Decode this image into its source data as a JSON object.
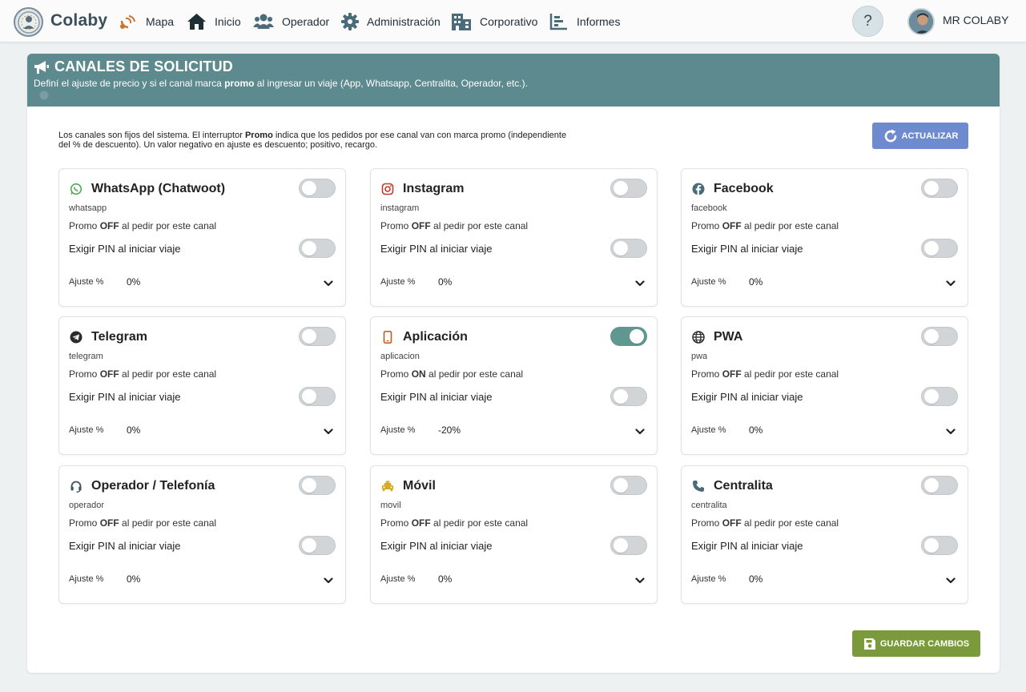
{
  "nav": {
    "brand_co": "Co",
    "brand_rest": "laby",
    "items": [
      {
        "label": "Mapa",
        "icon": "satellite-icon"
      },
      {
        "label": "Inicio",
        "icon": "home-icon"
      },
      {
        "label": "Operador",
        "icon": "users-icon"
      },
      {
        "label": "Administración",
        "icon": "gear-icon"
      },
      {
        "label": "Corporativo",
        "icon": "building-icon"
      },
      {
        "label": "Informes",
        "icon": "chart-icon"
      }
    ],
    "help": "?",
    "user_name": "MR COLABY"
  },
  "header": {
    "title": "CANALES DE SOLICITUD",
    "subtitle_pre": "Definí el ajuste de precio y si el canal marca ",
    "subtitle_bold": "promo",
    "subtitle_post": " al ingresar un viaje (App, Whatsapp, Centralita, Operador, etc.)."
  },
  "info": {
    "pre": "Los canales son fijos del sistema. El interruptor ",
    "bold": "Promo",
    "post": " indica que los pedidos por ese canal van con marca promo (independiente del % de descuento). Un valor negativo en ajuste es descuento; positivo, recargo."
  },
  "refresh_label": "ACTUALIZAR",
  "save_label": "GUARDAR CAMBIOS",
  "labels": {
    "promo_pre": "Promo ",
    "promo_post": " al pedir por este canal",
    "pin": "Exigir PIN al iniciar viaje",
    "adjust": "Ajuste %"
  },
  "channels": [
    {
      "name": "WhatsApp (Chatwoot)",
      "code": "whatsapp",
      "promo": "OFF",
      "promo_on": false,
      "pin_on": false,
      "adjust": "0%",
      "icon": "whatsapp-icon",
      "color": "#4caf50"
    },
    {
      "name": "Instagram",
      "code": "instagram",
      "promo": "OFF",
      "promo_on": false,
      "pin_on": false,
      "adjust": "0%",
      "icon": "instagram-icon",
      "color": "#c0392b"
    },
    {
      "name": "Facebook",
      "code": "facebook",
      "promo": "OFF",
      "promo_on": false,
      "pin_on": false,
      "adjust": "0%",
      "icon": "facebook-icon",
      "color": "#4a6b78"
    },
    {
      "name": "Telegram",
      "code": "telegram",
      "promo": "OFF",
      "promo_on": false,
      "pin_on": false,
      "adjust": "0%",
      "icon": "telegram-icon",
      "color": "#2b2b2b"
    },
    {
      "name": "Aplicación",
      "code": "aplicacion",
      "promo": "ON",
      "promo_on": true,
      "pin_on": false,
      "adjust": "-20%",
      "icon": "mobile-icon",
      "color": "#c0622b"
    },
    {
      "name": "PWA",
      "code": "pwa",
      "promo": "OFF",
      "promo_on": false,
      "pin_on": false,
      "adjust": "0%",
      "icon": "globe-icon",
      "color": "#2b2b2b"
    },
    {
      "name": "Operador / Telefonía",
      "code": "operador",
      "promo": "OFF",
      "promo_on": false,
      "pin_on": false,
      "adjust": "0%",
      "icon": "headset-icon",
      "color": "#3e5560"
    },
    {
      "name": "Móvil",
      "code": "movil",
      "promo": "OFF",
      "promo_on": false,
      "pin_on": false,
      "adjust": "0%",
      "icon": "taxi-icon",
      "color": "#d4a927"
    },
    {
      "name": "Centralita",
      "code": "centralita",
      "promo": "OFF",
      "promo_on": false,
      "pin_on": false,
      "adjust": "0%",
      "icon": "phone-icon",
      "color": "#4a6b78"
    }
  ],
  "colors": {
    "header": "#5d8a8f",
    "refresh": "#6f8bd0",
    "save": "#7a9a3b",
    "toggle_on": "#5e9891"
  }
}
